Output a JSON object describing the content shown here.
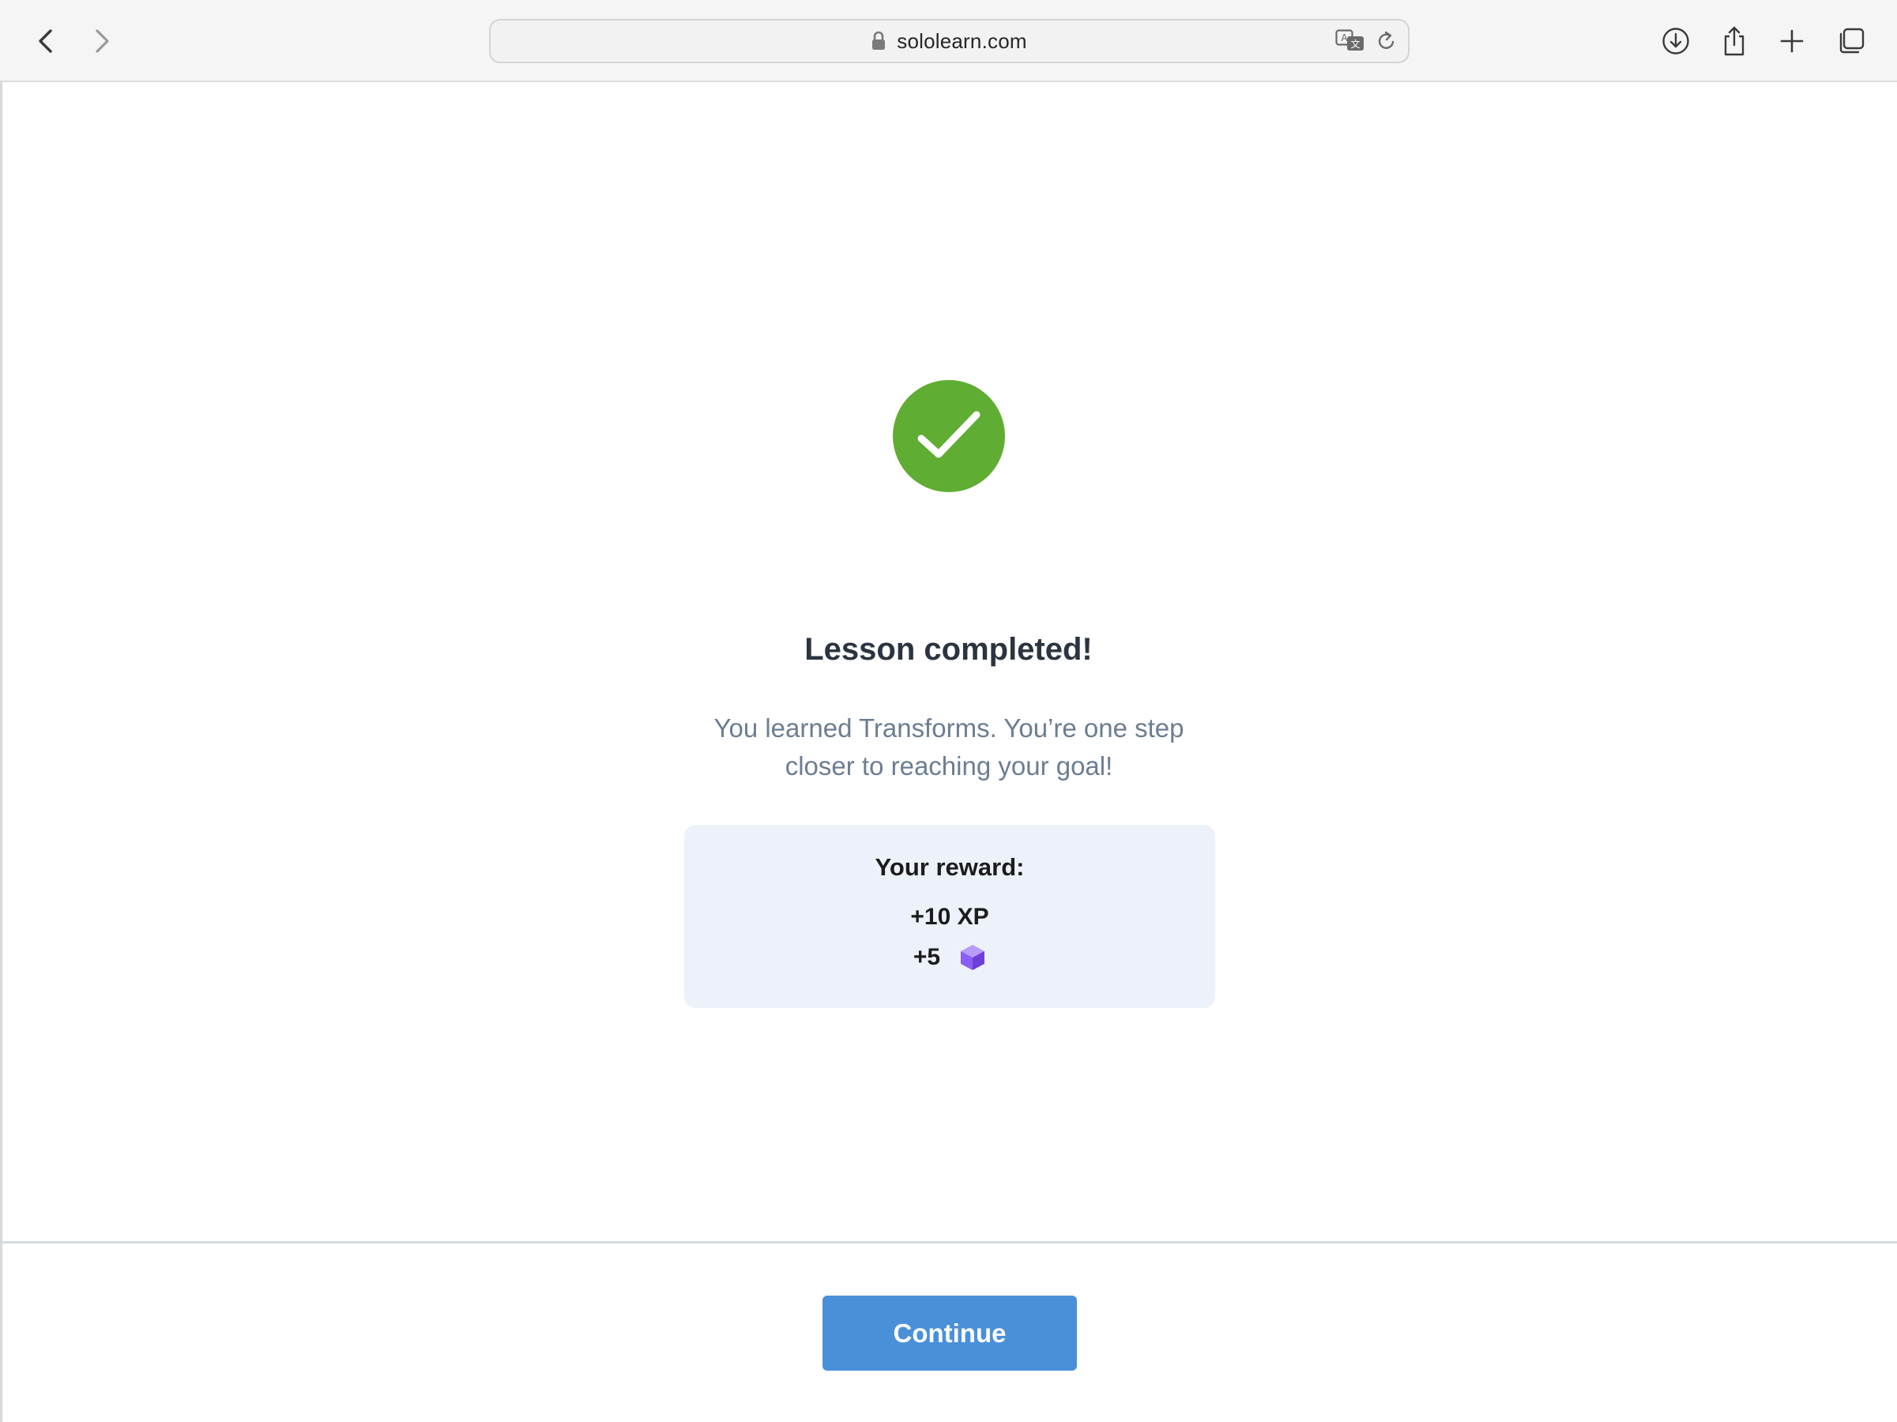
{
  "browser": {
    "url": "sololearn.com",
    "icons": {
      "back": "chevron-left-icon",
      "forward": "chevron-right-icon",
      "lock": "lock-icon",
      "translate": "translate-icon",
      "reload": "reload-icon",
      "downloads": "download-icon",
      "share": "share-icon",
      "new_tab": "plus-icon",
      "tabs_overview": "tabs-icon"
    }
  },
  "lesson_complete": {
    "status_icon": "checkmark-icon",
    "status_color": "#5fad32",
    "title": "Lesson completed!",
    "message_line1": "You learned Transforms. You’re one step",
    "message_line2": "closer to reaching your goal!"
  },
  "reward": {
    "title": "Your reward:",
    "xp": "+10 XP",
    "gems": "+5",
    "gem_icon": "gem-cube-icon",
    "gem_color": "#8b5cf6"
  },
  "footer": {
    "continue_label": "Continue",
    "continue_color": "#4a90d9"
  }
}
